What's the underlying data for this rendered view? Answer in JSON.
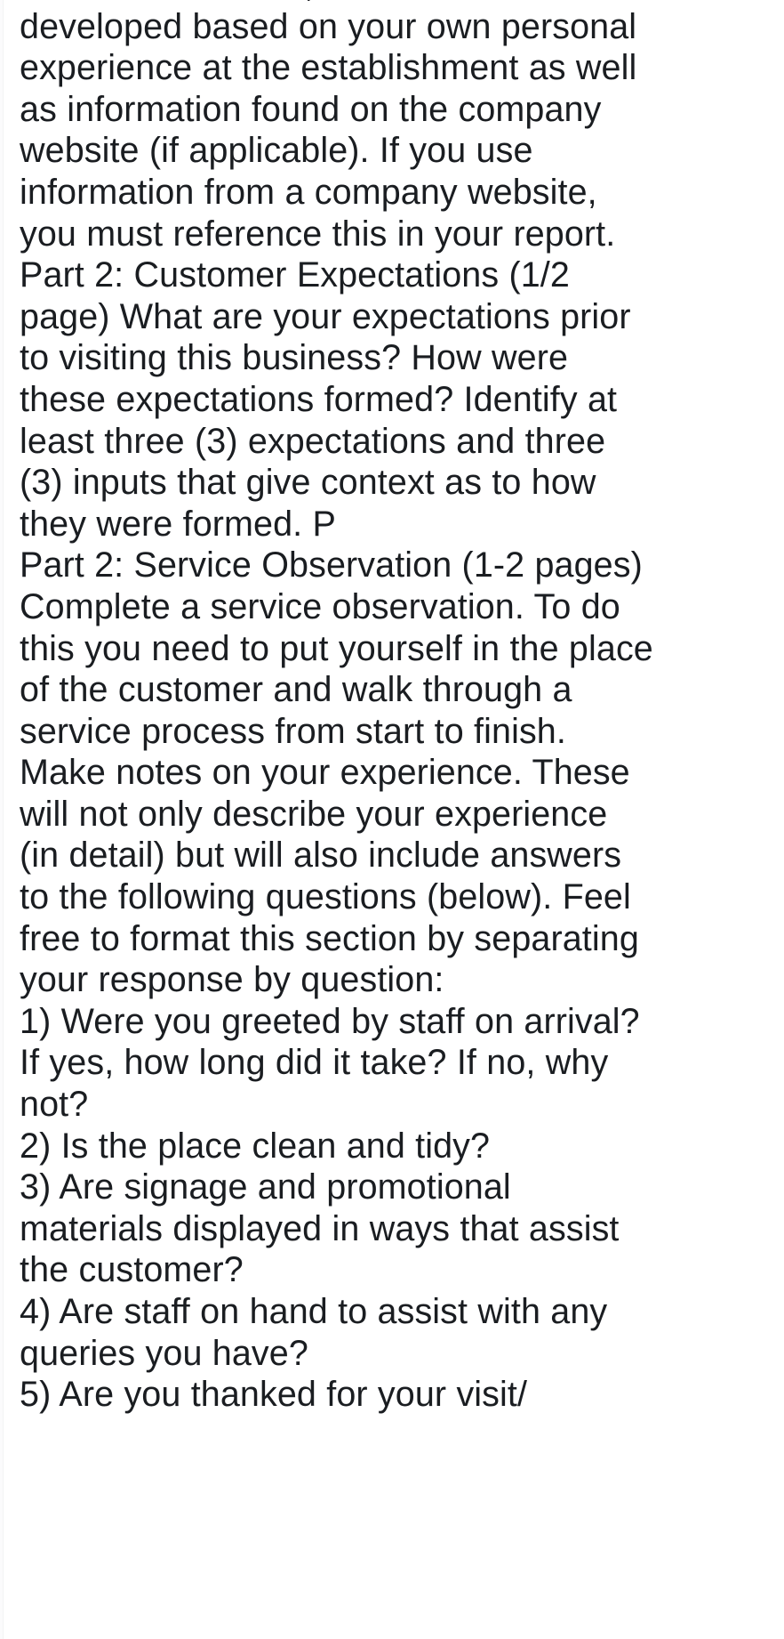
{
  "document": {
    "type": "plain-text-passage",
    "background_color": "#ffffff",
    "text_color": "#1a1d21",
    "clipped_top": true,
    "clipped_bottom": true,
    "paragraphs": [
      {
        "id": "intro-company-background",
        "clipped": true,
        "text": "mission statement, etc. This can be developed based on your own personal experience at the establishment as well as information found on the company website (if applicable). If you use information from a company website, you must reference this in your report."
      },
      {
        "id": "part-2-customer-expectations",
        "clipped": false,
        "text": "Part 2: Customer Expectations (1/2 page) What are your expectations prior to visiting this business? How were these expectations formed? Identify at least three (3) expectations and three (3) inputs that give context as to how they were formed. P"
      },
      {
        "id": "part-2-service-observation",
        "clipped": false,
        "text": "Part 2: Service Observation (1-2 pages) Complete a service observation. To do this you need to put yourself in the place of the customer and walk through a service process from start to finish. Make notes on your experience. These will not only describe your experience (in detail) but will also include answers to the following questions (below). Feel free to format this section by separating your response by question:"
      },
      {
        "id": "question-1",
        "clipped": false,
        "text": "1) Were you greeted by staff on arrival? If yes, how long did it take? If no, why not?"
      },
      {
        "id": "question-2",
        "clipped": false,
        "text": "2) Is the place clean and tidy?"
      },
      {
        "id": "question-3",
        "clipped": false,
        "text": "3) Are signage and promotional materials displayed in ways that assist the customer?"
      },
      {
        "id": "question-4",
        "clipped": false,
        "text": "4) Are staff on hand to assist with any queries you have?"
      },
      {
        "id": "question-5",
        "clipped": true,
        "text": "5) Are you thanked for your visit/"
      }
    ]
  }
}
